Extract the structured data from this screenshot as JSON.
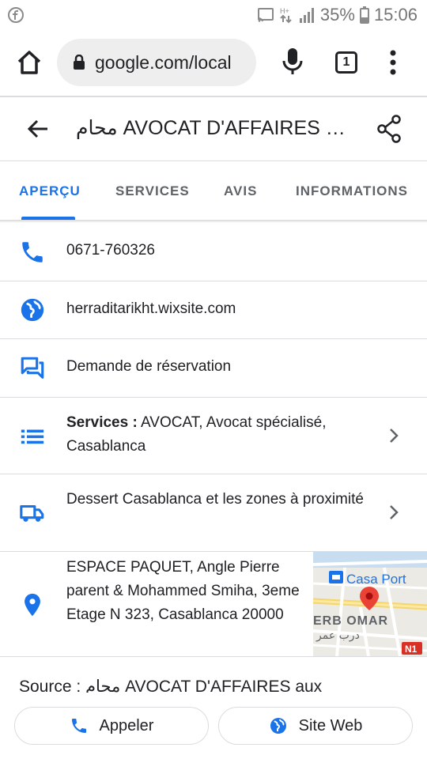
{
  "status_bar": {
    "battery": "35%",
    "time": "15:06"
  },
  "browser": {
    "url": "google.com/local",
    "tab_count": "1"
  },
  "header": {
    "title": "محام AVOCAT D'AFFAIRES aux"
  },
  "tabs": [
    {
      "label": "APERÇU",
      "active": true
    },
    {
      "label": "SERVICES",
      "active": false
    },
    {
      "label": "AVIS",
      "active": false
    },
    {
      "label": "INFORMATIONS",
      "active": false
    }
  ],
  "rows": {
    "phone": "0671-760326",
    "website": "herraditarikht.wixsite.com",
    "booking": "Demande de réservation",
    "services_label": "Services :",
    "services_value": "AVOCAT, Avocat spécialisé, Casablanca",
    "delivery": "Dessert Casablanca et les zones à proximité",
    "address": "ESPACE PAQUET, Angle Pierre parent & Mohammed Smiha, 3eme Etage N 323, Casablanca 20000"
  },
  "map": {
    "place_label": "Casa Port",
    "district_label": "ERB OMAR",
    "district_label_ar": "درب عمر",
    "road_badge": "N1"
  },
  "source": "Source : محام AVOCAT D'AFFAIRES aux",
  "actions": {
    "call_label": "Appeler",
    "website_label": "Site Web"
  },
  "colors": {
    "accent": "#1a73e8",
    "pin": "#ea4335"
  }
}
